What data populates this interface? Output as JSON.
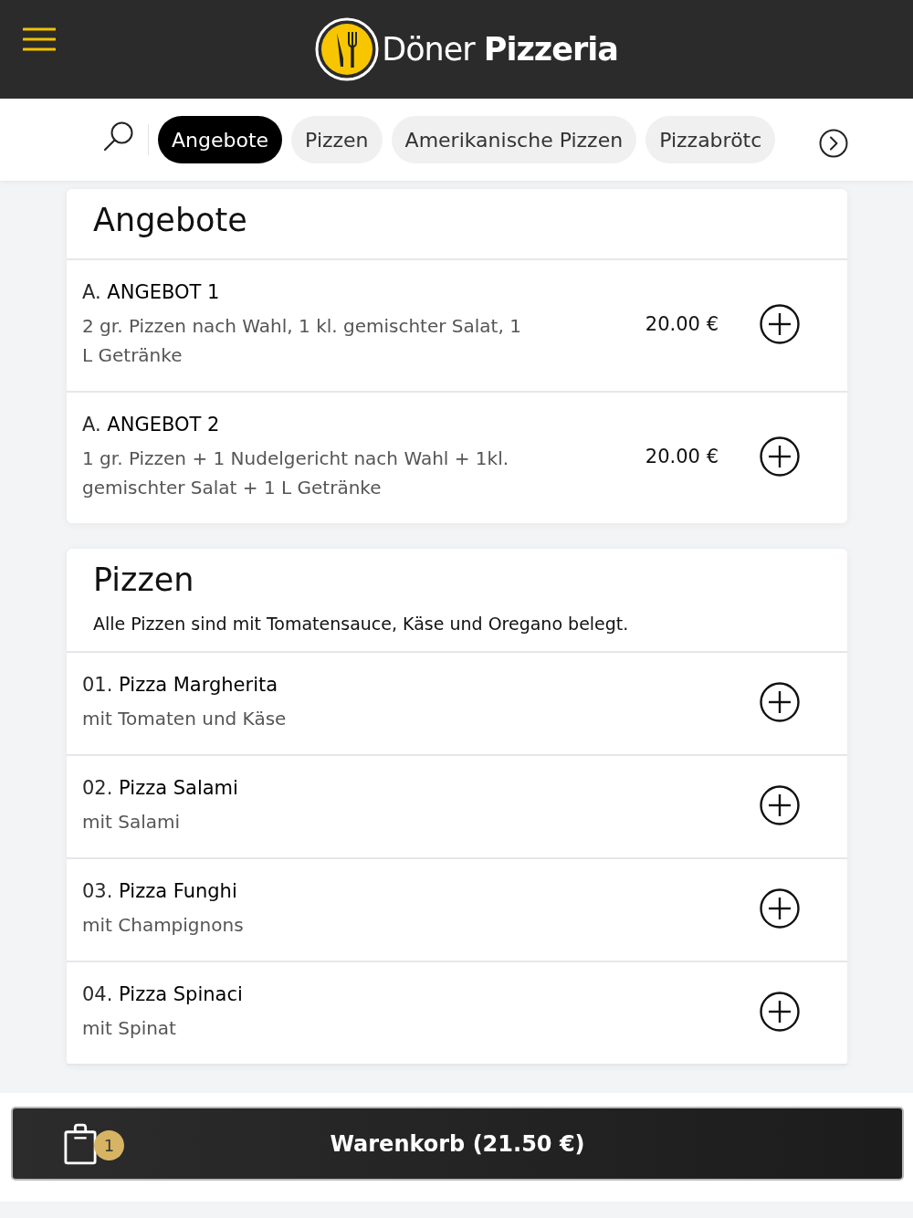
{
  "header": {
    "logo_text": "Döner **Pizzeria**"
  },
  "categories": [
    {
      "label": "Angebote",
      "selected": true
    },
    {
      "label": "Pizzen",
      "selected": false
    },
    {
      "label": "Amerikanische Pizzen",
      "selected": false
    },
    {
      "label": "Pizzabrötc",
      "selected": false
    }
  ],
  "sections": [
    {
      "title": "Angebote",
      "items": [
        {
          "number": "A.",
          "name": "ANGEBOT 1",
          "description": "2 gr. Pizzen nach Wahl, 1 kl. gemischter Salat, 1 L Getränke",
          "price": "20.00 €"
        },
        {
          "number": "A.",
          "name": "ANGEBOT 2",
          "description": "1 gr. Pizzen + 1 Nudelgericht nach Wahl + 1kl. gemischter Salat + 1 L Getränke",
          "price": "20.00 €"
        }
      ]
    },
    {
      "title": "Pizzen",
      "note": "Alle Pizzen sind mit Tomatensauce, Käse und Oregano belegt.",
      "items": [
        {
          "number": "01.",
          "name": "Pizza Margherita",
          "description": "mit Tomaten und Käse"
        },
        {
          "number": "02.",
          "name": "Pizza Salami",
          "description": "mit Salami"
        },
        {
          "number": "03.",
          "name": "Pizza Funghi",
          "description": "mit Champignons"
        },
        {
          "number": "04.",
          "name": "Pizza Spinaci",
          "description": "mit Spinat"
        }
      ]
    }
  ],
  "cart": {
    "count": "1",
    "label": "Warenkorb (21.50 €)"
  }
}
